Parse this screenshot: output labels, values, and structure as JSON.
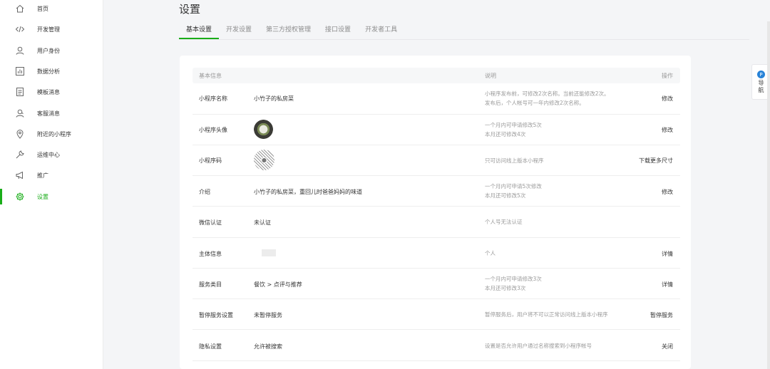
{
  "sidebar": {
    "items": [
      {
        "label": "首页",
        "icon": "home-icon"
      },
      {
        "label": "开发管理",
        "icon": "code-icon"
      },
      {
        "label": "用户身份",
        "icon": "user-icon"
      },
      {
        "label": "数据分析",
        "icon": "chart-icon"
      },
      {
        "label": "模板消息",
        "icon": "document-icon"
      },
      {
        "label": "客服消息",
        "icon": "customer-service-icon"
      },
      {
        "label": "附近的小程序",
        "icon": "location-icon"
      },
      {
        "label": "运维中心",
        "icon": "wrench-icon"
      },
      {
        "label": "推广",
        "icon": "megaphone-icon"
      },
      {
        "label": "设置",
        "icon": "gear-icon"
      }
    ],
    "active_index": 9
  },
  "page": {
    "title": "设置",
    "tabs": [
      "基本设置",
      "开发设置",
      "第三方授权管理",
      "接口设置",
      "开发者工具"
    ]
  },
  "table": {
    "headers": {
      "name": "基本信息",
      "desc": "说明",
      "op": "操作"
    },
    "rows": [
      {
        "name": "小程序名称",
        "value": "小竹子的私房菜",
        "desc": [
          "小程序发布前，可修改2次名称。当前还能修改2次。",
          "发布后，个人帐号可一年内修改2次名称。"
        ],
        "op": "修改"
      },
      {
        "name": "小程序头像",
        "value": "",
        "desc": [
          "一个月内可申请修改5次",
          "本月还可修改4次"
        ],
        "op": "修改"
      },
      {
        "name": "小程序码",
        "value": "",
        "desc": [
          "只可访问线上版本小程序"
        ],
        "op": "下载更多尺寸"
      },
      {
        "name": "介绍",
        "value": "小竹子的私房菜，重回儿时爸爸妈妈的味道",
        "desc": [
          "一个月内可申请5次修改",
          "本月还可修改5次"
        ],
        "op": "修改"
      },
      {
        "name": "微信认证",
        "value": "未认证",
        "desc": [
          "个人号无法认证"
        ],
        "op": ""
      },
      {
        "name": "主体信息",
        "value": "",
        "desc": [
          "个人"
        ],
        "op": "详情"
      },
      {
        "name": "服务类目",
        "value": "餐饮 > 点评与推荐",
        "desc": [
          "一个月内可申请修改3次",
          "本月还可修改3次"
        ],
        "op": "详情"
      },
      {
        "name": "暂停服务设置",
        "value": "未暂停服务",
        "desc": [
          "暂停服务后，用户将不可以正常访问线上版本小程序"
        ],
        "op": "暂停服务"
      },
      {
        "name": "隐私设置",
        "value": "允许被搜索",
        "desc": [
          "设置是否允许用户通过名称搜索到小程序帐号"
        ],
        "op": "关闭"
      }
    ]
  },
  "float_nav": {
    "badge": "P",
    "label": "导航"
  },
  "colors": {
    "accent": "#1aad19",
    "nav_badge": "#2782d7"
  }
}
